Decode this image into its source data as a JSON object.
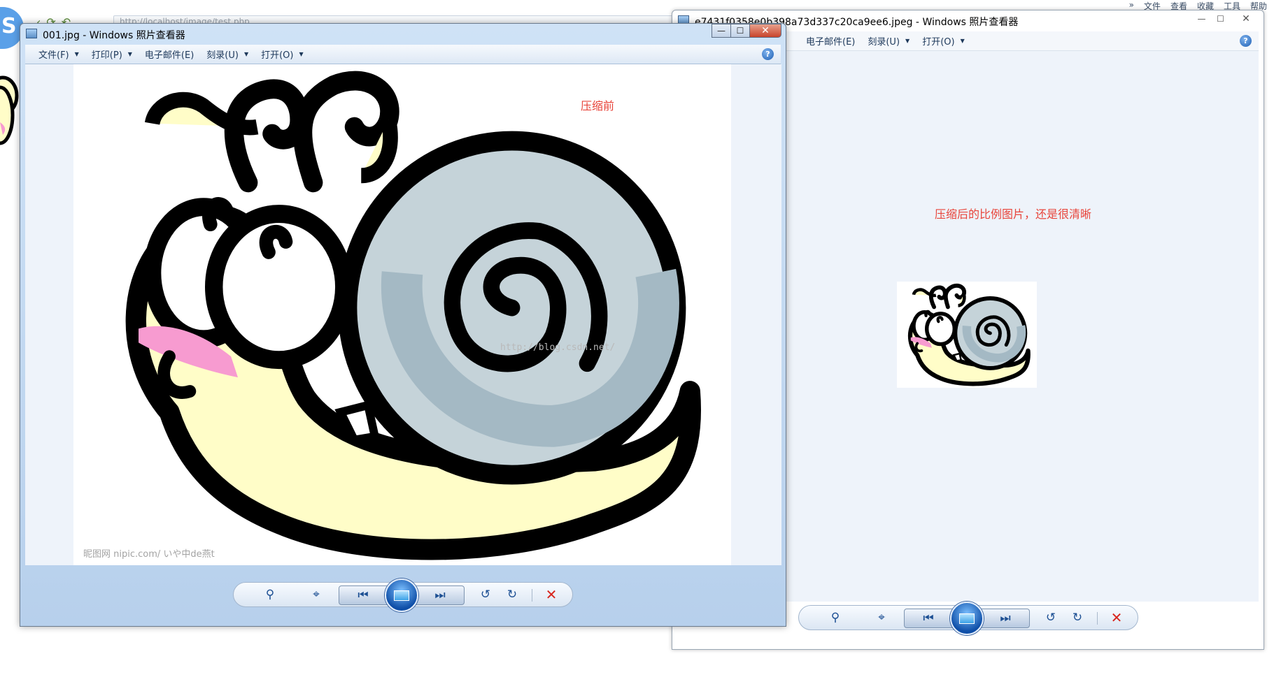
{
  "background_browser": {
    "address_text": "http://localhost/image/test.php",
    "menu": [
      "»",
      "文件",
      "查看",
      "收藏",
      "工具",
      "帮助"
    ]
  },
  "window_original": {
    "title": "001.jpg - Windows 照片查看器",
    "menu": [
      {
        "label": "文件(F)",
        "dropdown": true
      },
      {
        "label": "打印(P)",
        "dropdown": true
      },
      {
        "label": "电子邮件(E)",
        "dropdown": false
      },
      {
        "label": "刻录(U)",
        "dropdown": true
      },
      {
        "label": "打开(O)",
        "dropdown": true
      }
    ],
    "caption": "压缩前",
    "watermark_site": "昵图网 nipic.com/ いや中de燕t",
    "watermark_blog": "http://blog.csdn.net/"
  },
  "window_compressed": {
    "title": "e7431f0358e0b398a73d337c20ca9ee6.jpeg - Windows 照片查看器",
    "menu": [
      {
        "label": "电子邮件(E)",
        "dropdown": false
      },
      {
        "label": "刻录(U)",
        "dropdown": true
      },
      {
        "label": "打开(O)",
        "dropdown": true
      }
    ],
    "caption": "压缩后的比例图片，还是很清晰"
  },
  "controls": {
    "min": "—",
    "max": "☐",
    "close": "✕",
    "help": "?"
  },
  "toolbar_icons": {
    "zoom": "⚲",
    "fit": "⌖",
    "prev": "⏮",
    "next": "⏭",
    "rotate_ccw": "↺",
    "rotate_cw": "↻",
    "delete": "✕"
  },
  "colors": {
    "snail_body": "#fffdc8",
    "snail_shell": "#c5d3d9",
    "snail_shell_dark": "#a4b9c4",
    "snail_mouth": "#f79bd0",
    "caption_red": "#e8443a"
  }
}
